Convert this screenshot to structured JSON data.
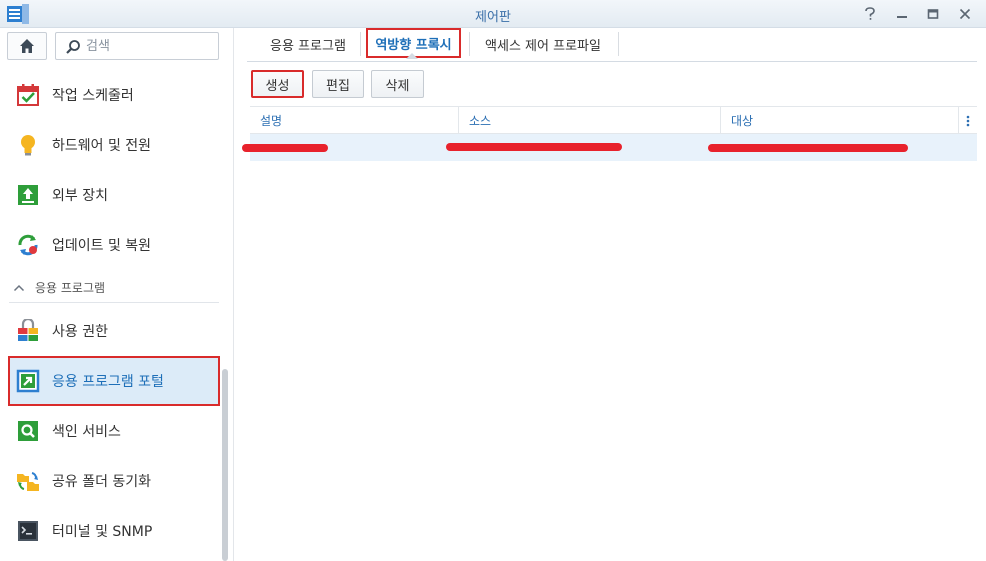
{
  "window": {
    "title": "제어판"
  },
  "sidebar": {
    "search_placeholder": "검색",
    "items_top": [
      {
        "label": "작업 스케줄러",
        "icon": "task-scheduler-icon"
      },
      {
        "label": "하드웨어 및 전원",
        "icon": "lightbulb-icon"
      },
      {
        "label": "외부 장치",
        "icon": "external-device-icon"
      },
      {
        "label": "업데이트 및 복원",
        "icon": "update-restore-icon"
      }
    ],
    "section_label": "응용 프로그램",
    "items_apps": [
      {
        "label": "사용 권한",
        "icon": "privileges-icon"
      },
      {
        "label": "응용 프로그램 포털",
        "icon": "application-portal-icon",
        "selected": true
      },
      {
        "label": "색인 서비스",
        "icon": "indexing-service-icon"
      },
      {
        "label": "공유 폴더 동기화",
        "icon": "shared-folder-sync-icon"
      },
      {
        "label": "터미널 및 SNMP",
        "icon": "terminal-icon"
      }
    ]
  },
  "main": {
    "tabs": [
      {
        "label": "응용 프로그램"
      },
      {
        "label": "역방향 프록시",
        "active": true
      },
      {
        "label": "액세스 제어 프로파일"
      }
    ],
    "toolbar": {
      "create_label": "생성",
      "edit_label": "편집",
      "delete_label": "삭제"
    },
    "grid": {
      "columns": [
        "설명",
        "소스",
        "대상"
      ]
    }
  },
  "colors": {
    "accent": "#1e6fb8",
    "selected_row": "#e8f2fb",
    "highlight_box": "#d92b2b",
    "redaction": "#e8222c"
  }
}
